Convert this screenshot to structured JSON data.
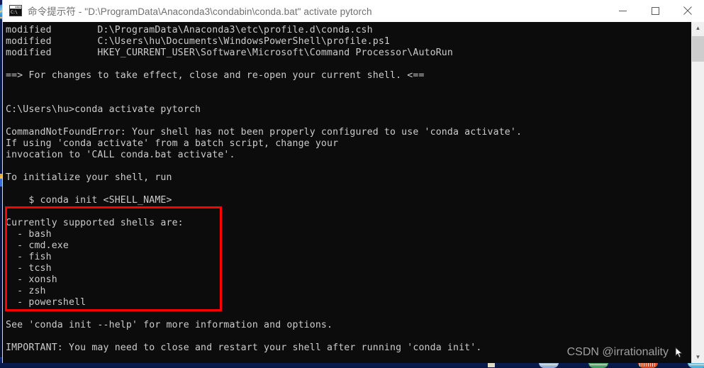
{
  "window": {
    "icon_name": "console-icon",
    "icon_glyph": "C:\\",
    "title": "命令提示符 - \"D:\\ProgramData\\Anaconda3\\condabin\\conda.bat\"  activate pytorch",
    "controls": {
      "minimize_label": "Minimize",
      "maximize_label": "Maximize",
      "close_label": "Close"
    }
  },
  "console": {
    "background_color": "#0c0c0c",
    "text_color": "#cccccc",
    "text": "modified        D:\\ProgramData\\Anaconda3\\etc\\profile.d\\conda.csh\nmodified        C:\\Users\\hu\\Documents\\WindowsPowerShell\\profile.ps1\nmodified        HKEY_CURRENT_USER\\Software\\Microsoft\\Command Processor\\AutoRun\n\n==> For changes to take effect, close and re-open your current shell. <==\n\n\nC:\\Users\\hu>conda activate pytorch\n\nCommandNotFoundError: Your shell has not been properly configured to use 'conda activate'.\nIf using 'conda activate' from a batch script, change your\ninvocation to 'CALL conda.bat activate'.\n\nTo initialize your shell, run\n\n    $ conda init <SHELL_NAME>\n\nCurrently supported shells are:\n  - bash\n  - cmd.exe\n  - fish\n  - tcsh\n  - xonsh\n  - zsh\n  - powershell\n\nSee 'conda init --help' for more information and options.\n\nIMPORTANT: You may need to close and restart your shell after running 'conda init'.",
    "lines": [
      "modified        D:\\ProgramData\\Anaconda3\\etc\\profile.d\\conda.csh",
      "modified        C:\\Users\\hu\\Documents\\WindowsPowerShell\\profile.ps1",
      "modified        HKEY_CURRENT_USER\\Software\\Microsoft\\Command Processor\\AutoRun",
      "",
      "==> For changes to take effect, close and re-open your current shell. <==",
      "",
      "",
      "C:\\Users\\hu>conda activate pytorch",
      "",
      "CommandNotFoundError: Your shell has not been properly configured to use 'conda activate'.",
      "If using 'conda activate' from a batch script, change your",
      "invocation to 'CALL conda.bat activate'.",
      "",
      "To initialize your shell, run",
      "",
      "    $ conda init <SHELL_NAME>",
      "",
      "Currently supported shells are:",
      "  - bash",
      "  - cmd.exe",
      "  - fish",
      "  - tcsh",
      "  - xonsh",
      "  - zsh",
      "  - powershell",
      "",
      "See 'conda init --help' for more information and options.",
      "",
      "IMPORTANT: You may need to close and restart your shell after running 'conda init'."
    ],
    "prompt": "C:\\Users\\hu>",
    "command_entered": "conda activate pytorch",
    "error_name": "CommandNotFoundError",
    "supported_shells": [
      "bash",
      "cmd.exe",
      "fish",
      "tcsh",
      "xonsh",
      "zsh",
      "powershell"
    ]
  },
  "annotation": {
    "color": "#fe0000",
    "target": "supported shells list"
  },
  "watermark": {
    "text": "CSDN @irrationality",
    "color": "#b9b9b9"
  },
  "scrollbar": {
    "up_arrow": "▲",
    "down_arrow": "▼"
  }
}
